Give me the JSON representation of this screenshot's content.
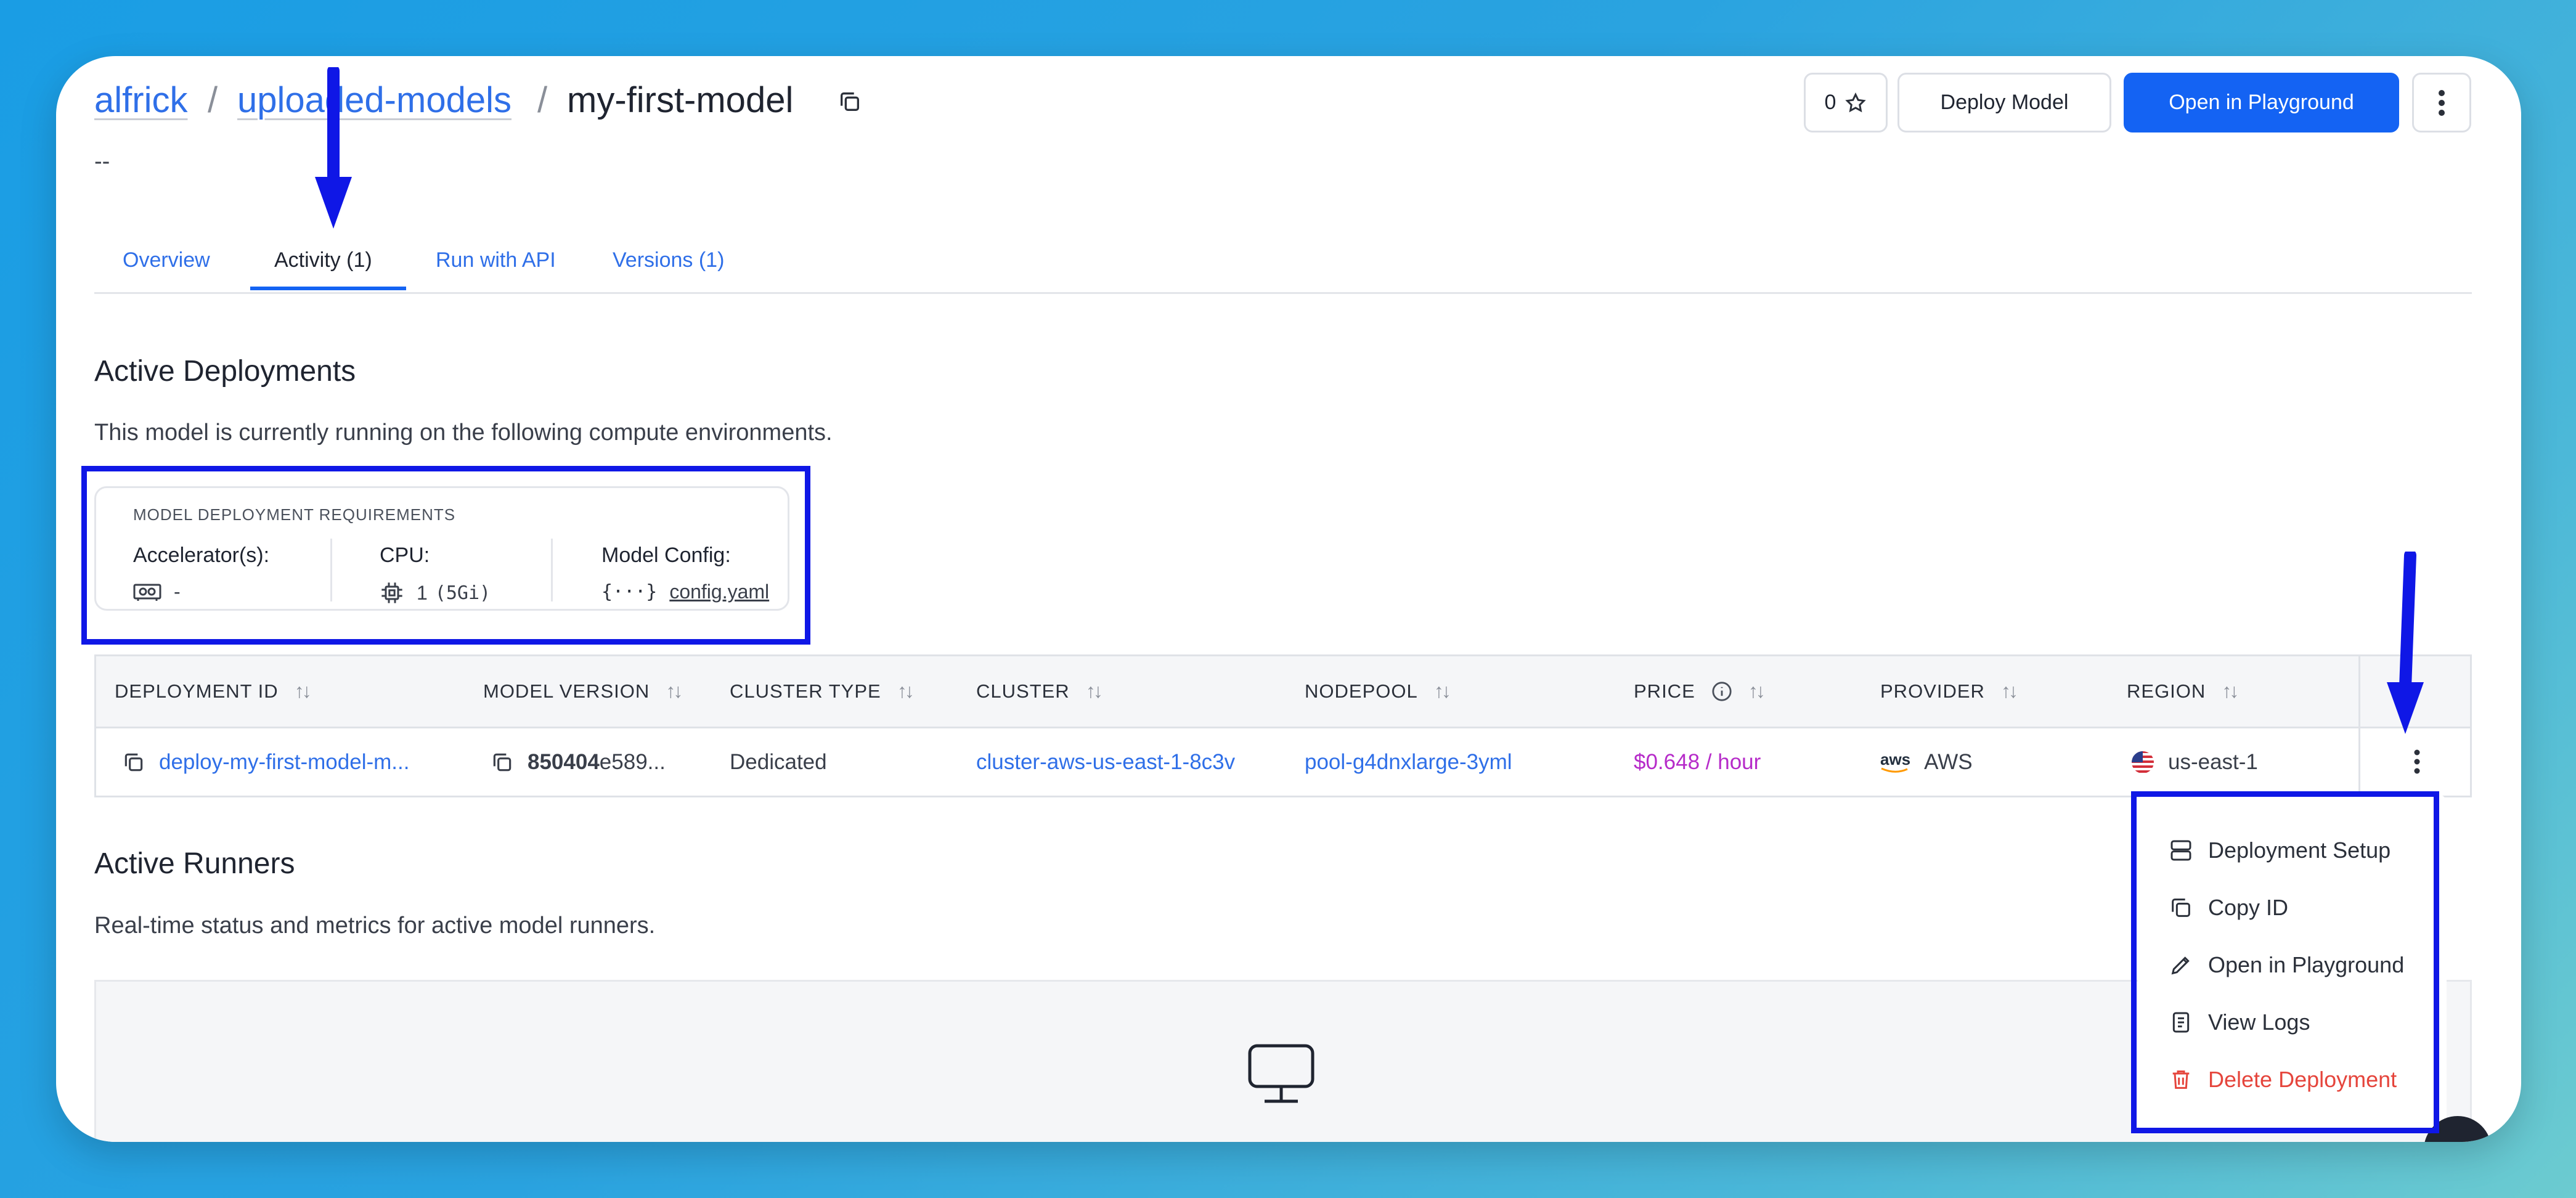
{
  "breadcrumb": {
    "owner": "alfrick",
    "app": "uploaded-models",
    "model": "my-first-model"
  },
  "description": "--",
  "header": {
    "star_count": "0",
    "deploy_label": "Deploy Model",
    "playground_label": "Open in Playground"
  },
  "tabs": [
    {
      "label": "Overview"
    },
    {
      "label": "Activity (1)"
    },
    {
      "label": "Run with API"
    },
    {
      "label": "Versions (1)"
    }
  ],
  "active_deployments": {
    "title": "Active Deployments",
    "subtitle": "This model is currently running on the following compute environments."
  },
  "requirements": {
    "title": "MODEL DEPLOYMENT REQUIREMENTS",
    "accelerator_label": "Accelerator(s):",
    "accelerator_value": "-",
    "cpu_label": "CPU:",
    "cpu_value": "1",
    "cpu_mem": "(5Gi)",
    "config_label": "Model Config:",
    "config_value": "config.yaml"
  },
  "table": {
    "headers": [
      "DEPLOYMENT ID",
      "MODEL VERSION",
      "CLUSTER TYPE",
      "CLUSTER",
      "NODEPOOL",
      "PRICE",
      "PROVIDER",
      "REGION"
    ],
    "row": {
      "deployment_id": "deploy-my-first-model-m...",
      "model_version_bold": "850404",
      "model_version_rest": "e589...",
      "cluster_type": "Dedicated",
      "cluster": "cluster-aws-us-east-1-8c3v",
      "nodepool": "pool-g4dnxlarge-3yml",
      "price": "$0.648 / hour",
      "provider_logo": "aws",
      "provider": "AWS",
      "region": "us-east-1"
    }
  },
  "menu": {
    "items": [
      {
        "label": "Deployment Setup",
        "icon": "server-icon"
      },
      {
        "label": "Copy ID",
        "icon": "copy-icon"
      },
      {
        "label": "Open in Playground",
        "icon": "pencil-icon"
      },
      {
        "label": "View Logs",
        "icon": "document-icon"
      },
      {
        "label": "Delete Deployment",
        "icon": "trash-icon",
        "color": "#e5453c"
      }
    ]
  },
  "active_runners": {
    "title": "Active Runners",
    "subtitle": "Real-time status and metrics for active model runners."
  },
  "colors": {
    "accent": "#1463f3",
    "link": "#2f6fe8",
    "price": "#b62bc9",
    "danger": "#e5453c",
    "annotation": "#0f17e6"
  }
}
